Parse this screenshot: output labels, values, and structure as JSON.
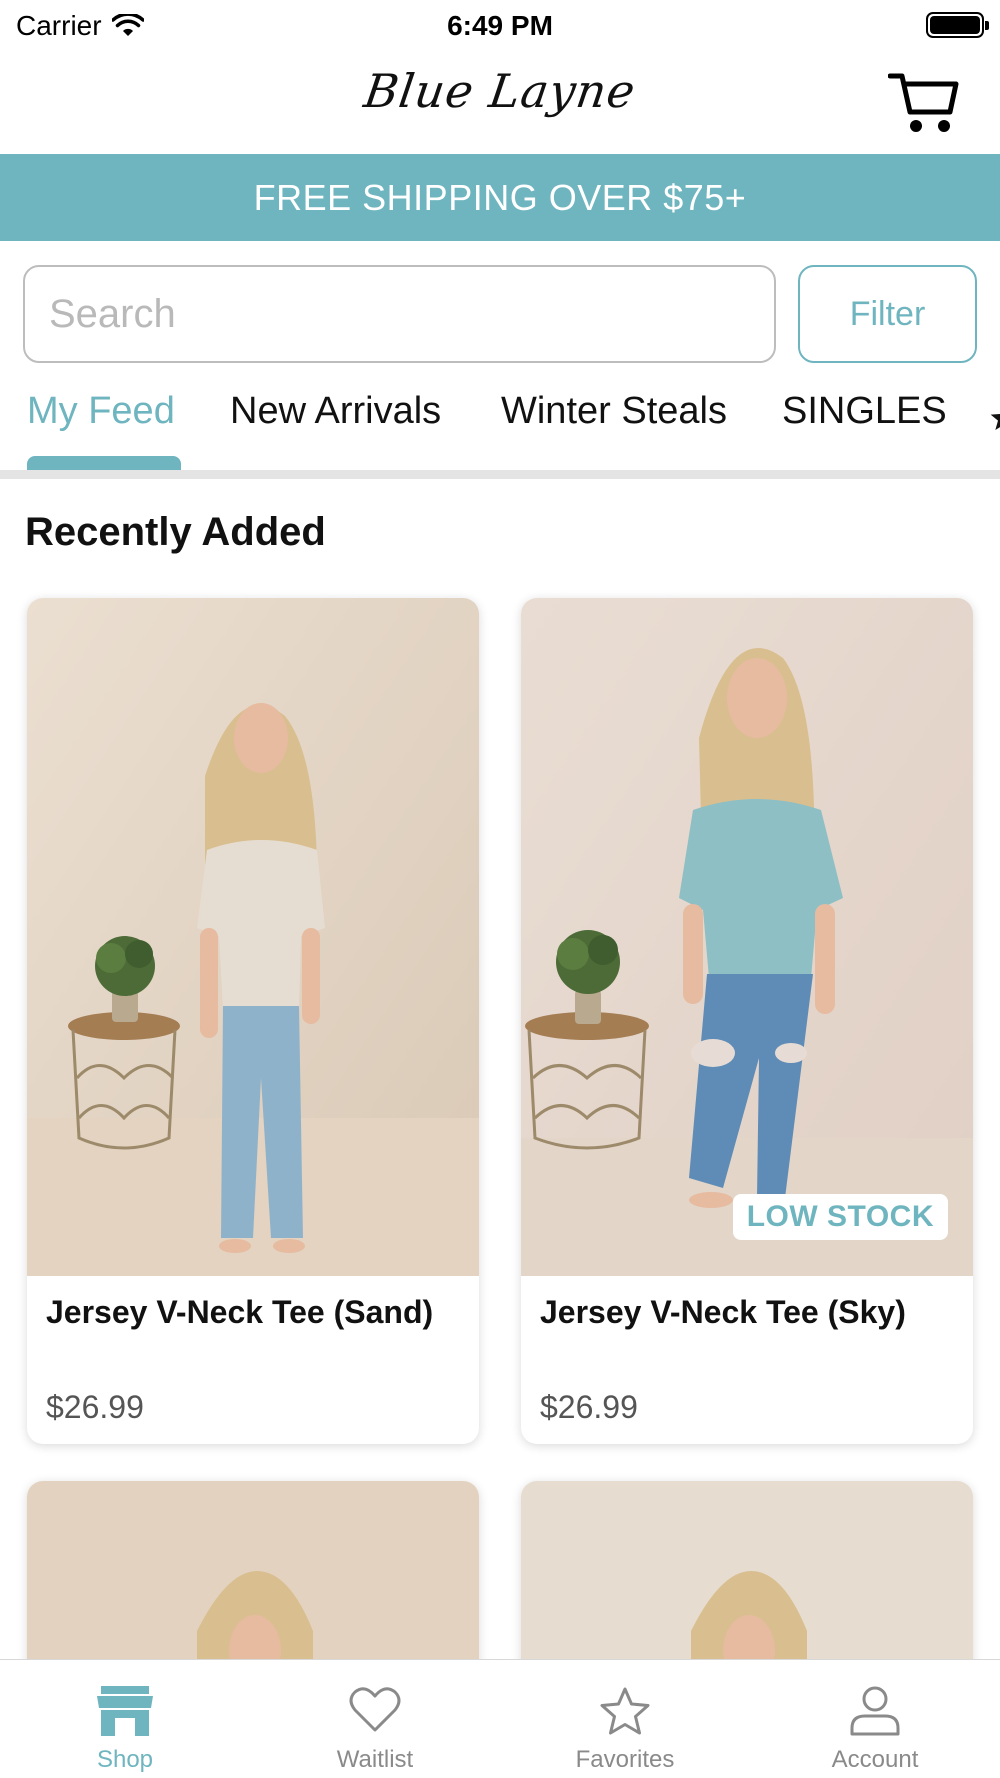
{
  "status_bar": {
    "carrier": "Carrier",
    "time": "6:49 PM",
    "battery_level": 1.0
  },
  "header": {
    "logo_text": "Blue Layne",
    "cart_icon": "cart-icon"
  },
  "banner": {
    "text": "FREE SHIPPING OVER $75+",
    "background": "#6fb5bf"
  },
  "search": {
    "placeholder": "Search",
    "value": ""
  },
  "filter": {
    "label": "Filter"
  },
  "tabs": [
    {
      "label": "My Feed",
      "active": true
    },
    {
      "label": "New Arrivals",
      "active": false
    },
    {
      "label": "Winter Steals",
      "active": false
    },
    {
      "label": "SINGLES",
      "active": false
    }
  ],
  "section": {
    "title": "Recently Added"
  },
  "products": [
    {
      "name": "Jersey V-Neck Tee (Sand)",
      "price": "$26.99",
      "badge": "",
      "shirt_color": "#e6ddd2"
    },
    {
      "name": "Jersey V-Neck Tee (Sky)",
      "price": "$26.99",
      "badge": "LOW STOCK",
      "shirt_color": "#8ebfc4"
    },
    {
      "name": "",
      "price": "",
      "badge": ""
    },
    {
      "name": "",
      "price": "",
      "badge": ""
    }
  ],
  "tab_bar": [
    {
      "label": "Shop",
      "icon": "shop-icon",
      "active": true
    },
    {
      "label": "Waitlist",
      "icon": "heart-icon",
      "active": false
    },
    {
      "label": "Favorites",
      "icon": "star-icon",
      "active": false
    },
    {
      "label": "Account",
      "icon": "account-icon",
      "active": false
    }
  ],
  "colors": {
    "accent": "#6fb5bf",
    "divider": "#e4e4e4",
    "price_text": "#555555"
  }
}
